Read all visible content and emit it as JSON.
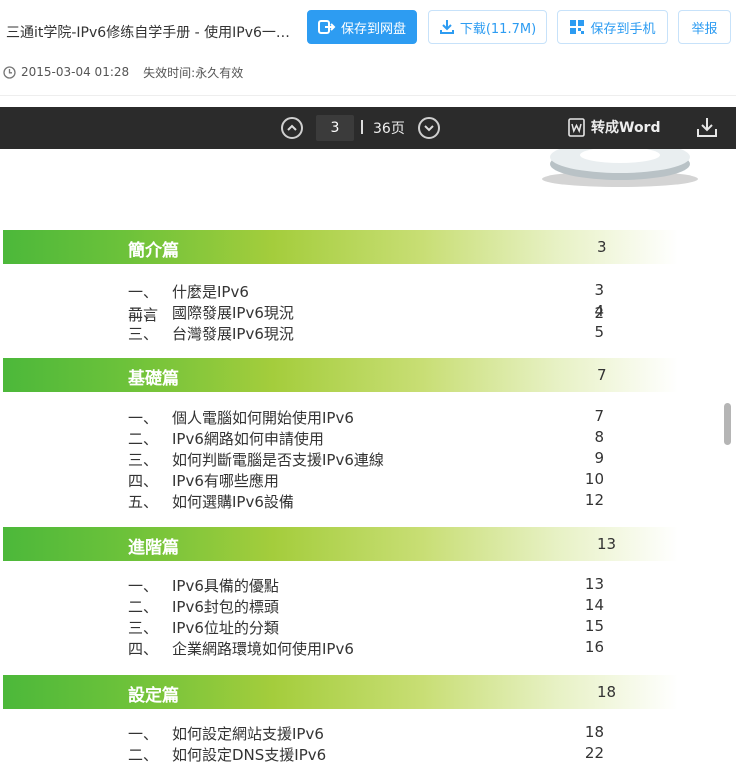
{
  "header": {
    "title": "三通it学院-IPv6修练自学手册 - 使用IPv6一次...",
    "buttons": {
      "save_disk": "保存到网盘",
      "download": "下载(11.7M)",
      "save_phone": "保存到手机",
      "report": "举报"
    },
    "meta": {
      "date": "2015-03-04 01:28",
      "expire_label": "失效时间:",
      "expire_value": "永久有效"
    }
  },
  "viewer": {
    "current_page": "3",
    "total_pages": "36页",
    "to_word": "转成Word"
  },
  "toc": {
    "preface": {
      "label": "前言",
      "page": "2"
    },
    "sections": [
      {
        "title": "簡介篇",
        "page": "3",
        "items": [
          {
            "num": "一、",
            "text": "什麼是IPv6",
            "page": "3"
          },
          {
            "num": "二、",
            "text": "國際發展IPv6現況",
            "page": "4"
          },
          {
            "num": "三、",
            "text": "台灣發展IPv6現況",
            "page": "5"
          }
        ]
      },
      {
        "title": "基礎篇",
        "page": "7",
        "items": [
          {
            "num": "一、",
            "text": "個人電腦如何開始使用IPv6",
            "page": "7"
          },
          {
            "num": "二、",
            "text": "IPv6網路如何申請使用",
            "page": "8"
          },
          {
            "num": "三、",
            "text": "如何判斷電腦是否支援IPv6連線",
            "page": "9"
          },
          {
            "num": "四、",
            "text": "IPv6有哪些應用",
            "page": "10"
          },
          {
            "num": "五、",
            "text": "如何選購IPv6設備",
            "page": "12"
          }
        ]
      },
      {
        "title": "進階篇",
        "page": "13",
        "items": [
          {
            "num": "一、",
            "text": "IPv6具備的優點",
            "page": "13"
          },
          {
            "num": "二、",
            "text": "IPv6封包的標頭",
            "page": "14"
          },
          {
            "num": "三、",
            "text": "IPv6位址的分類",
            "page": "15"
          },
          {
            "num": "四、",
            "text": "企業網路環境如何使用IPv6",
            "page": "16"
          }
        ]
      },
      {
        "title": "設定篇",
        "page": "18",
        "items": [
          {
            "num": "一、",
            "text": "如何設定網站支援IPv6",
            "page": "18"
          },
          {
            "num": "二、",
            "text": "如何設定DNS支援IPv6",
            "page": "22"
          }
        ]
      }
    ]
  },
  "colors": {
    "accent": "#2d9cf2",
    "toolbar": "#2b2b2b",
    "band_green": "#4cb83a"
  }
}
